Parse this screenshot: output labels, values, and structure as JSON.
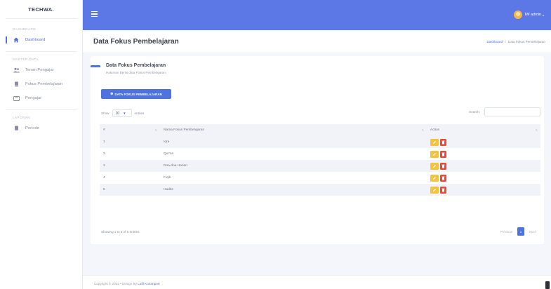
{
  "brand": "TECHWA.",
  "sidebar": {
    "sections": [
      {
        "heading": "DASHBOARD",
        "items": [
          {
            "label": "Dashboard",
            "icon": "home-icon",
            "active": true
          }
        ]
      },
      {
        "heading": "MASTER DATA",
        "items": [
          {
            "label": "Tenan Pengajar",
            "icon": "users-icon",
            "active": false
          },
          {
            "label": "Fokus Pembelajaran",
            "icon": "book-icon",
            "active": false
          },
          {
            "label": "Pengajar",
            "icon": "card-icon",
            "active": false
          }
        ]
      },
      {
        "heading": "LAPORAN",
        "items": [
          {
            "label": "Periode",
            "icon": "book-icon",
            "active": false
          }
        ]
      }
    ]
  },
  "topbar": {
    "user_name": "IW admin",
    "accent": "#5b78e6"
  },
  "page": {
    "title": "Data Fokus Pembelajaran",
    "breadcrumb": {
      "home": "Dashboard",
      "separator": "/",
      "current": "Data Fokus Pembelajaran"
    }
  },
  "card": {
    "title": "Data Fokus Pembelajaran",
    "subtitle": "Halaman Berisi data Fokus Pembelajaran",
    "add_button": "DATA FOKUS PEMBELAJARAN"
  },
  "table_controls": {
    "show_label": "Show",
    "show_value": "10",
    "entries_label": "entries",
    "search_label": "Search:"
  },
  "table": {
    "headers": [
      "#",
      "Nama Fokus Pembelajaran",
      "Action"
    ],
    "rows": [
      {
        "no": "1",
        "name": "Iqra"
      },
      {
        "no": "2",
        "name": "Qur'an"
      },
      {
        "no": "3",
        "name": "Doa-doa Harian"
      },
      {
        "no": "4",
        "name": "Fiqih"
      },
      {
        "no": "5",
        "name": "Hadits"
      }
    ]
  },
  "pagination": {
    "info": "Showing 1 to 5 of 5 entries",
    "previous": "Previous",
    "current": "1",
    "next": "Next"
  },
  "footer": {
    "prefix": "Copyright © 2024 • Design By",
    "author": "Lutfi Koromport"
  },
  "colors": {
    "primary": "#4e73df",
    "edit": "#f6c23e",
    "delete": "#e74a3b"
  }
}
